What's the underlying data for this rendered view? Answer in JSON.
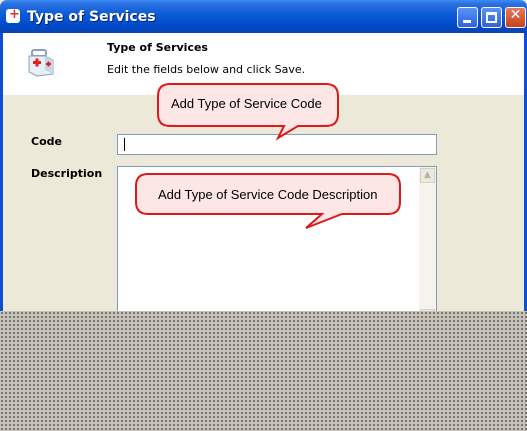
{
  "window": {
    "title": "Type of Services",
    "app_icon": "first-aid-kit-icon"
  },
  "header": {
    "title": "Type of Services",
    "subtitle": "Edit the fields below and click Save.",
    "icon": "first-aid-kit-icon"
  },
  "form": {
    "code_label": "Code",
    "code_value": "",
    "description_label": "Description",
    "description_value": ""
  },
  "callouts": {
    "code": "Add Type of Service Code",
    "description": "Add Type of Service Code Description"
  },
  "colors": {
    "titlebar": "#0a5bd8",
    "dialog_bg": "#ece9d8",
    "callout_fill": "#fde6e6",
    "callout_border": "#e01818"
  }
}
